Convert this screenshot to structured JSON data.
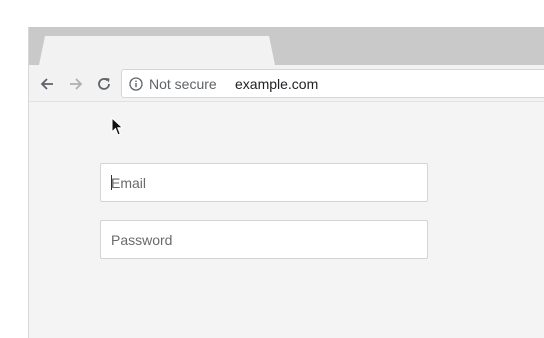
{
  "toolbar": {
    "back_icon": "arrow-left-icon",
    "forward_icon": "arrow-right-icon",
    "reload_icon": "reload-icon"
  },
  "address_bar": {
    "security_icon": "info-icon",
    "security_label": "Not secure",
    "url": "example.com"
  },
  "form": {
    "email_placeholder": "Email",
    "email_value": "",
    "password_placeholder": "Password",
    "password_value": ""
  },
  "colors": {
    "tabstrip": "#c9c9c9",
    "toolbar": "#f2f2f2",
    "page_background": "#f4f4f4"
  }
}
